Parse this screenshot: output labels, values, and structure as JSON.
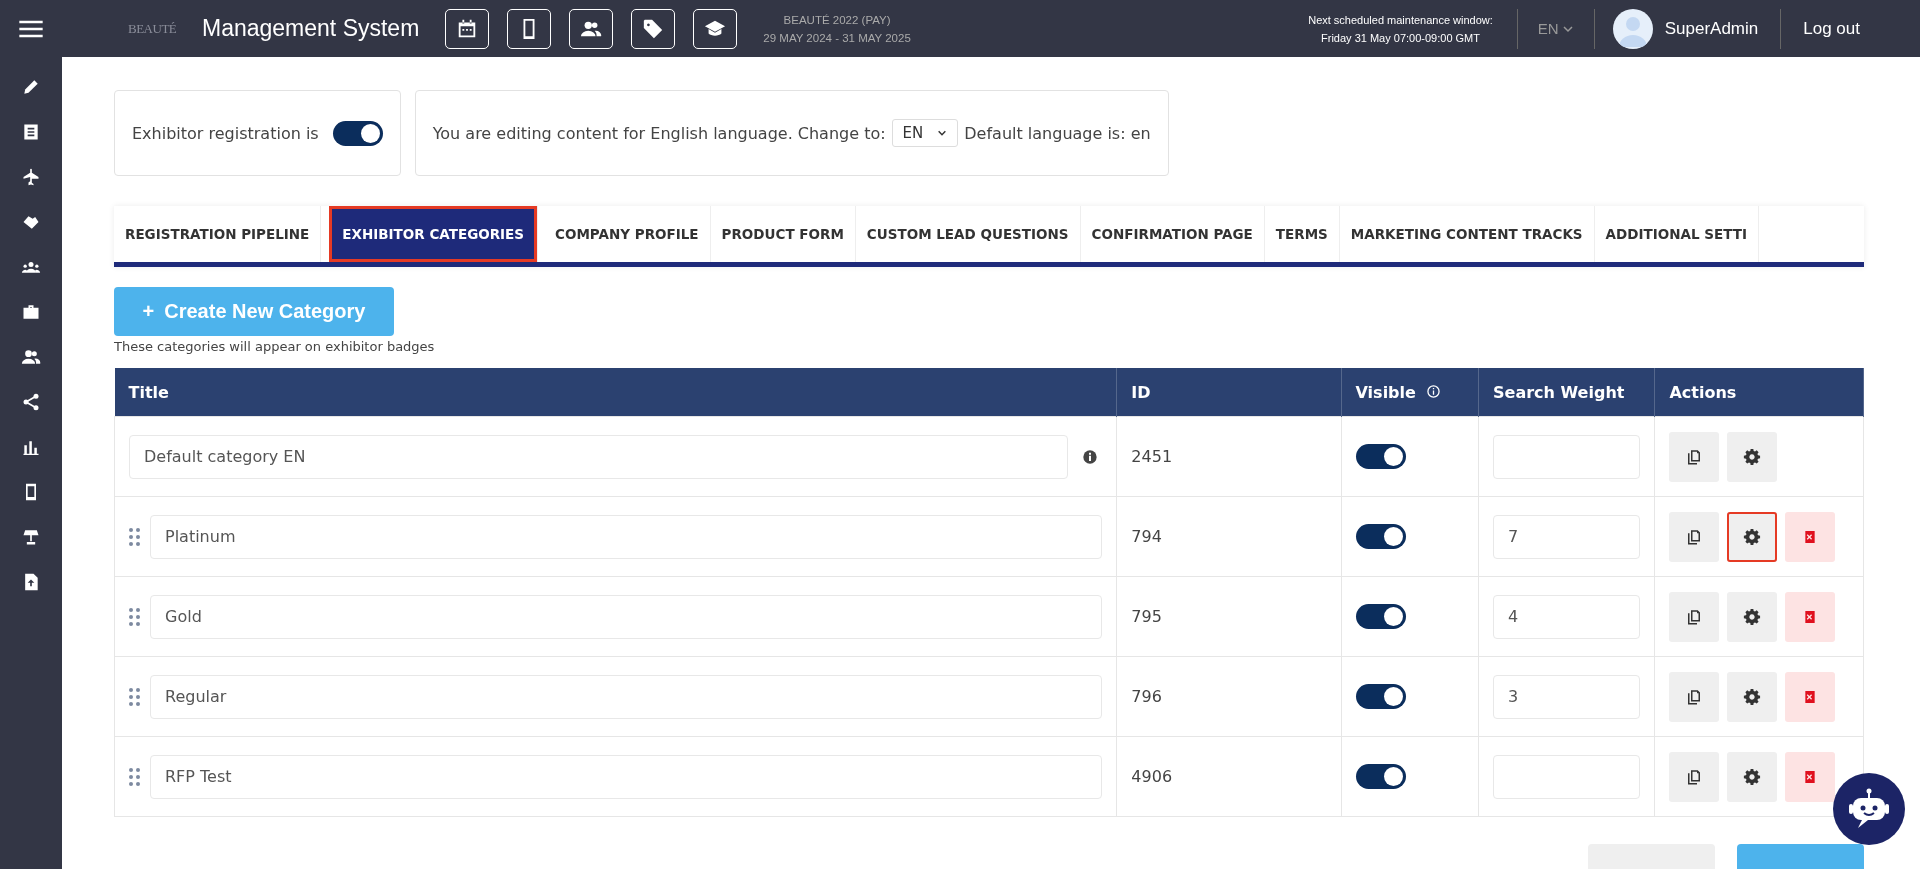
{
  "topbar": {
    "logo": "BEAUTÉ",
    "title": "Management System",
    "event_name": "BEAUTÉ 2022 (PAY)",
    "event_dates": "29 MAY 2024 - 31 MAY 2025",
    "maintenance_line1": "Next scheduled maintenance window:",
    "maintenance_line2": "Friday 31 May 07:00-09:00 GMT",
    "language": "EN",
    "user": "SuperAdmin",
    "logout": "Log out"
  },
  "registration": {
    "label": "Exhibitor registration is",
    "on": true
  },
  "language_bar": {
    "prefix": "You are editing content for English language. Change to:",
    "value": "EN",
    "suffix": "Default language is: en"
  },
  "tabs": [
    {
      "label": "REGISTRATION PIPELINE",
      "selected": false,
      "highlighted": false
    },
    {
      "label": "EXHIBITOR CATEGORIES",
      "selected": true,
      "highlighted": true
    },
    {
      "label": "COMPANY PROFILE",
      "selected": false,
      "highlighted": false
    },
    {
      "label": "PRODUCT FORM",
      "selected": false,
      "highlighted": false
    },
    {
      "label": "CUSTOM LEAD QUESTIONS",
      "selected": false,
      "highlighted": false
    },
    {
      "label": "CONFIRMATION PAGE",
      "selected": false,
      "highlighted": false
    },
    {
      "label": "TERMS",
      "selected": false,
      "highlighted": false
    },
    {
      "label": "MARKETING CONTENT TRACKS",
      "selected": false,
      "highlighted": false
    },
    {
      "label": "ADDITIONAL SETTI",
      "selected": false,
      "highlighted": false
    }
  ],
  "create_button": {
    "label": "Create New Category",
    "icon": "+"
  },
  "caption": "These categories will appear on exhibitor badges",
  "table": {
    "columns": [
      "Title",
      "ID",
      "Visible",
      "Search Weight",
      "Actions"
    ],
    "rows": [
      {
        "kind": "default",
        "title": "Default category EN",
        "id": "2451",
        "visible": true,
        "settings_highlighted": false
      },
      {
        "kind": "category",
        "title": "Platinum",
        "id": "794",
        "visible": true,
        "weight": "7",
        "settings_highlighted": true
      },
      {
        "kind": "category",
        "title": "Gold",
        "id": "795",
        "visible": true,
        "weight": "4",
        "settings_highlighted": false
      },
      {
        "kind": "category",
        "title": "Regular",
        "id": "796",
        "visible": true,
        "weight": "3",
        "settings_highlighted": false
      },
      {
        "kind": "category",
        "title": "RFP Test",
        "id": "4906",
        "visible": true,
        "settings_highlighted": false
      }
    ]
  }
}
